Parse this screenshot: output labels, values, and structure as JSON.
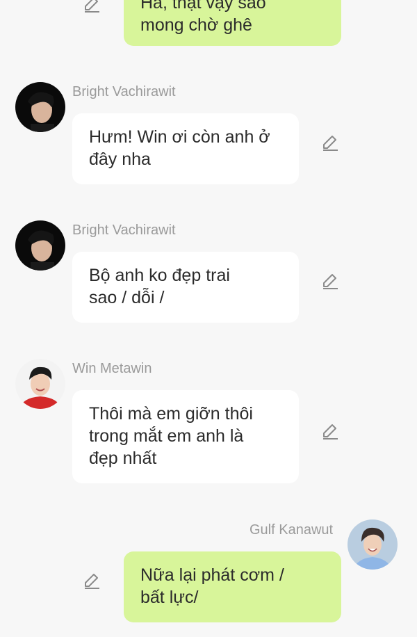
{
  "messages": [
    {
      "direction": "out",
      "sender": "",
      "text": "Hả, thật vậy sao\nmong chờ ghê",
      "edit_icon": "pencil-icon"
    },
    {
      "direction": "in",
      "sender": "Bright Vachirawit",
      "text": "Hưm! Win ơi còn anh ở\nđây nha",
      "avatar_icon": "avatar-dark-hair",
      "edit_icon": "pencil-icon"
    },
    {
      "direction": "in",
      "sender": "Bright Vachirawit",
      "text": "Bộ anh ko đẹp trai\nsao / dỗi /",
      "avatar_icon": "avatar-dark-hair",
      "edit_icon": "pencil-icon"
    },
    {
      "direction": "in",
      "sender": "Win Metawin",
      "text": "Thôi mà em giỡn thôi\ntrong mắt em anh là\nđẹp nhất",
      "avatar_icon": "avatar-red-shirt",
      "edit_icon": "pencil-icon"
    },
    {
      "direction": "out",
      "sender": "Gulf Kanawut",
      "text": "Nữa lại phát cơm /\nbất lực/",
      "avatar_icon": "avatar-blue-shirt",
      "edit_icon": "pencil-icon"
    }
  ],
  "colors": {
    "background": "#f7f7f7",
    "incoming_bubble": "#ffffff",
    "outgoing_bubble": "#d8f59a",
    "sender_name": "#9a9a9a",
    "message_text": "#2b2b2b"
  }
}
